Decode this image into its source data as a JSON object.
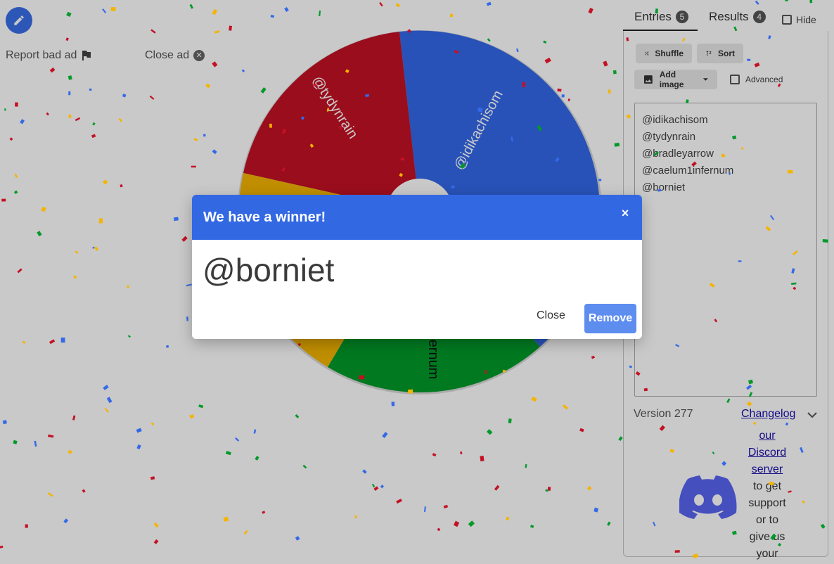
{
  "ads": {
    "report_label": "Report bad ad",
    "close_label": "Close ad"
  },
  "wheel": {
    "colors": {
      "red": "#c41124",
      "blue": "#3369e8",
      "yellow": "#f4b400",
      "green": "#019a29"
    },
    "segments": [
      {
        "label": "@idikachisom",
        "color": "#3369e8"
      },
      {
        "label": "@tydynrain",
        "color": "#c41124"
      },
      {
        "label": "@caelum1infernum",
        "color": "#019a29"
      }
    ]
  },
  "panel": {
    "tabs": [
      {
        "label": "Entries",
        "count": "5"
      },
      {
        "label": "Results",
        "count": "4"
      }
    ],
    "hide_label": "Hide",
    "shuffle_label": "Shuffle",
    "sort_label": "Sort",
    "add_image_label": "Add image",
    "advanced_label": "Advanced",
    "entries": [
      "@idikachisom",
      "@tydynrain",
      "@bradleyarrow",
      "@caelum1infernum",
      "@borniet"
    ],
    "version": "Version 277",
    "changelog_label": "Changelog",
    "discord_lines": [
      "our",
      "Discord",
      "server",
      "to get",
      "support",
      "or to",
      "give us",
      "your"
    ]
  },
  "dialog": {
    "title": "We have a winner!",
    "close_x": "×",
    "winner": "@borniet",
    "close_label": "Close",
    "remove_label": "Remove"
  }
}
